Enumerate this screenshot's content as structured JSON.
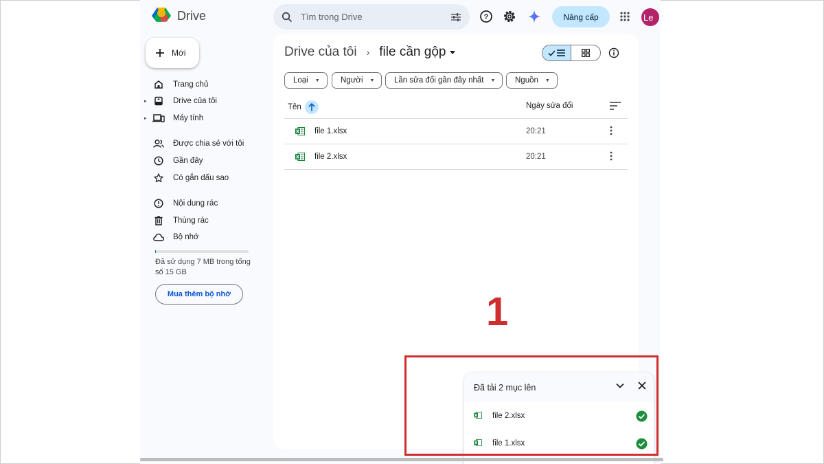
{
  "app": {
    "name": "Drive"
  },
  "search": {
    "placeholder": "Tìm trong Drive"
  },
  "header": {
    "upgrade_label": "Nâng cấp",
    "avatar_initials": "Le"
  },
  "sidebar": {
    "new_label": "Mới",
    "items": [
      {
        "label": "Trang chủ",
        "icon": "home-icon"
      },
      {
        "label": "Drive của tôi",
        "icon": "my-drive-icon"
      },
      {
        "label": "Máy tính",
        "icon": "computers-icon"
      },
      {
        "label": "Được chia sẻ với tôi",
        "icon": "shared-icon"
      },
      {
        "label": "Gần đây",
        "icon": "clock-icon"
      },
      {
        "label": "Có gắn dấu sao",
        "icon": "star-icon"
      },
      {
        "label": "Nội dung rác",
        "icon": "spam-icon"
      },
      {
        "label": "Thùng rác",
        "icon": "trash-icon"
      },
      {
        "label": "Bộ nhớ",
        "icon": "cloud-icon"
      }
    ],
    "storage_text": "Đã sử dụng 7 MB trong tổng số 15 GB",
    "storage_used_fraction": 0.0005,
    "buy_storage_label": "Mua thêm bộ nhớ"
  },
  "breadcrumb": {
    "root": "Drive của tôi",
    "current": "file cần gộp"
  },
  "filters": [
    "Loại",
    "Người",
    "Lần sửa đổi gần đây nhất",
    "Nguồn"
  ],
  "table": {
    "columns": {
      "name": "Tên",
      "modified": "Ngày sửa đổi"
    },
    "rows": [
      {
        "name": "file 1.xlsx",
        "modified": "20:21"
      },
      {
        "name": "file 2.xlsx",
        "modified": "20:21"
      }
    ]
  },
  "annotation": {
    "number": "1",
    "color": "#cf2e2e"
  },
  "upload_panel": {
    "title": "Đã tải 2 mục lên",
    "items": [
      {
        "name": "file 2.xlsx",
        "status": "done"
      },
      {
        "name": "file 1.xlsx",
        "status": "done"
      }
    ]
  },
  "colors": {
    "accent": "#0b57d0",
    "selected": "#c2e7ff",
    "excel": "#188038",
    "success": "#1e8e3e"
  }
}
